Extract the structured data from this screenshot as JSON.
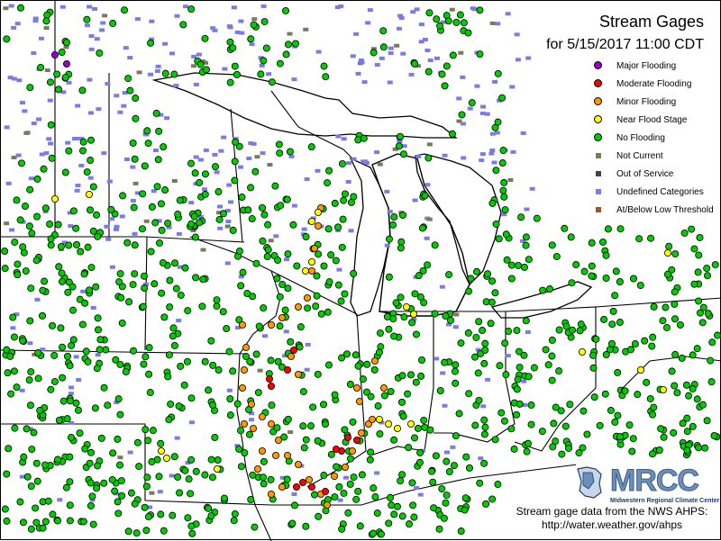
{
  "title": "Stream Gages",
  "subtitle": "for 5/15/2017 11:00 CDT",
  "legend": [
    {
      "label": "Major Flooding",
      "kind": "dot",
      "color": "#9900cc",
      "icon": "purple-dot-icon"
    },
    {
      "label": "Moderate Flooding",
      "kind": "dot",
      "color": "#ff0000",
      "icon": "red-dot-icon"
    },
    {
      "label": "Minor Flooding",
      "kind": "dot",
      "color": "#ff9900",
      "icon": "orange-dot-icon"
    },
    {
      "label": "Near Flood Stage",
      "kind": "dot",
      "color": "#ffff00",
      "icon": "yellow-dot-icon"
    },
    {
      "label": "No Flooding",
      "kind": "dot",
      "color": "#00cc00",
      "icon": "green-dot-icon"
    },
    {
      "label": "Not Current",
      "kind": "square",
      "color": "#7a7a5a",
      "icon": "olive-square-icon"
    },
    {
      "label": "Out of Service",
      "kind": "square",
      "color": "#444444",
      "icon": "dark-gray-square-icon"
    },
    {
      "label": "Undefined Categories",
      "kind": "square",
      "color": "#7b7be6",
      "icon": "blue-square-icon"
    },
    {
      "label": "At/Below Low Threshold",
      "kind": "square",
      "color": "#a0522d",
      "icon": "brown-square-icon"
    }
  ],
  "logo": {
    "name": "MRCC",
    "subtitle": "Midwestern Regional Climate Center"
  },
  "credits": {
    "line1": "Stream gage data from the NWS AHPS:",
    "line2": "http://water.weather.gov/ahps"
  },
  "colors": {
    "major": "#9900cc",
    "moderate": "#ff0000",
    "minor": "#ff9900",
    "near": "#ffff00",
    "none": "#00cc00",
    "undefined": "#7b7be6",
    "not_current": "#7a7a5a"
  }
}
